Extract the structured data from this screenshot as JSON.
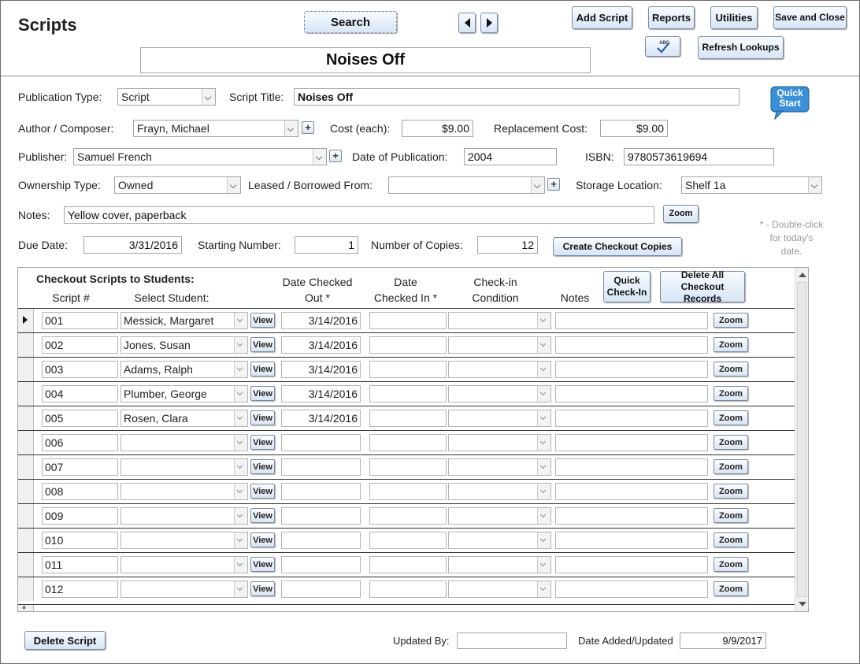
{
  "header": {
    "title": "Scripts",
    "search_label": "Search",
    "add_script_label": "Add Script",
    "reports_label": "Reports",
    "utilities_label": "Utilities",
    "save_close_label": "Save and Close",
    "spellcheck_icon": "spell-check-icon",
    "refresh_lookups_label": "Refresh Lookups",
    "record_title": "Noises Off"
  },
  "form": {
    "publication_type_label": "Publication Type:",
    "publication_type_value": "Script",
    "script_title_label": "Script Title:",
    "script_title_value": "Noises Off",
    "quick_start_label": "Quick Start",
    "author_label": "Author / Composer:",
    "author_value": "Frayn, Michael",
    "cost_label": "Cost (each):",
    "cost_value": "$9.00",
    "replacement_cost_label": "Replacement Cost:",
    "replacement_cost_value": "$9.00",
    "publisher_label": "Publisher:",
    "publisher_value": "Samuel French",
    "date_pub_label": "Date of Publication:",
    "date_pub_value": "2004",
    "isbn_label": "ISBN:",
    "isbn_value": "9780573619694",
    "ownership_label": "Ownership Type:",
    "ownership_value": "Owned",
    "leased_label": "Leased / Borrowed From:",
    "leased_value": "",
    "storage_label": "Storage Location:",
    "storage_value": "Shelf 1a",
    "notes_label": "Notes:",
    "notes_value": "Yellow cover, paperback",
    "zoom_label": "Zoom",
    "due_date_label": "Due Date:",
    "due_date_value": "3/31/2016",
    "starting_number_label": "Starting Number:",
    "starting_number_value": "1",
    "num_copies_label": "Number of Copies:",
    "num_copies_value": "12",
    "create_copies_label": "Create Checkout Copies",
    "hint": "* - Double-click for today's date."
  },
  "checkout": {
    "section_title": "Checkout Scripts to Students:",
    "col_script": "Script #",
    "col_student": "Select Student:",
    "col_date_out": "Date Checked Out *",
    "col_date_in": "Date Checked In *",
    "col_condition": "Check-in Condition",
    "col_notes": "Notes",
    "quick_checkin_label": "Quick Check-In",
    "delete_all_label": "Delete All Checkout Records",
    "view_label": "View",
    "zoom_label": "Zoom",
    "new_row_marker": "*",
    "rows": [
      {
        "script": "001",
        "student": "Messick, Margaret",
        "date_out": "3/14/2016",
        "date_in": "",
        "condition": "",
        "notes": ""
      },
      {
        "script": "002",
        "student": "Jones, Susan",
        "date_out": "3/14/2016",
        "date_in": "",
        "condition": "",
        "notes": ""
      },
      {
        "script": "003",
        "student": "Adams, Ralph",
        "date_out": "3/14/2016",
        "date_in": "",
        "condition": "",
        "notes": ""
      },
      {
        "script": "004",
        "student": "Plumber, George",
        "date_out": "3/14/2016",
        "date_in": "",
        "condition": "",
        "notes": ""
      },
      {
        "script": "005",
        "student": "Rosen, Clara",
        "date_out": "3/14/2016",
        "date_in": "",
        "condition": "",
        "notes": ""
      },
      {
        "script": "006",
        "student": "",
        "date_out": "",
        "date_in": "",
        "condition": "",
        "notes": ""
      },
      {
        "script": "007",
        "student": "",
        "date_out": "",
        "date_in": "",
        "condition": "",
        "notes": ""
      },
      {
        "script": "008",
        "student": "",
        "date_out": "",
        "date_in": "",
        "condition": "",
        "notes": ""
      },
      {
        "script": "009",
        "student": "",
        "date_out": "",
        "date_in": "",
        "condition": "",
        "notes": ""
      },
      {
        "script": "010",
        "student": "",
        "date_out": "",
        "date_in": "",
        "condition": "",
        "notes": ""
      },
      {
        "script": "011",
        "student": "",
        "date_out": "",
        "date_in": "",
        "condition": "",
        "notes": ""
      },
      {
        "script": "012",
        "student": "",
        "date_out": "",
        "date_in": "",
        "condition": "",
        "notes": ""
      }
    ]
  },
  "footer": {
    "delete_script_label": "Delete Script",
    "updated_by_label": "Updated By:",
    "updated_by_value": "",
    "date_added_label": "Date Added/Updated",
    "date_added_value": "9/9/2017"
  },
  "colors": {
    "button_top": "#f7fbff",
    "button_bottom": "#d7e5f5",
    "quick_start_blue": "#3b8fd6"
  }
}
